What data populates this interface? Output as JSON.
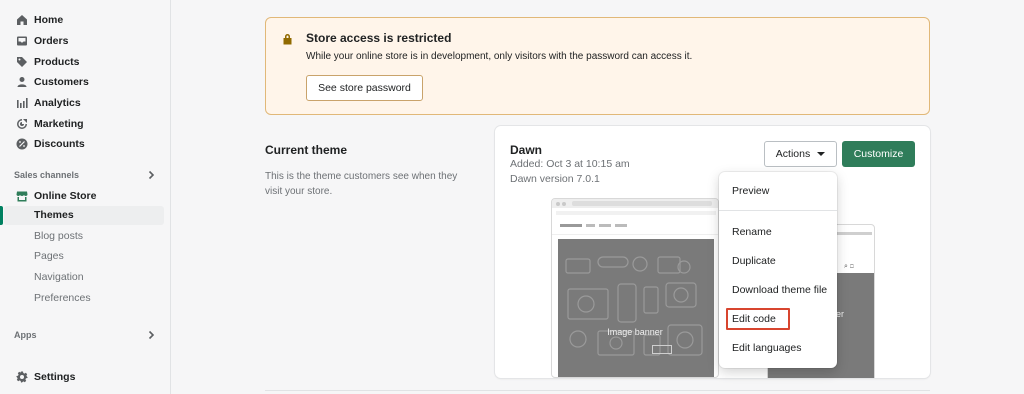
{
  "sidebar": {
    "nav": [
      {
        "label": "Home",
        "icon": "home-icon"
      },
      {
        "label": "Orders",
        "icon": "orders-icon"
      },
      {
        "label": "Products",
        "icon": "tag-icon"
      },
      {
        "label": "Customers",
        "icon": "person-icon"
      },
      {
        "label": "Analytics",
        "icon": "bar-chart-icon"
      },
      {
        "label": "Marketing",
        "icon": "target-icon"
      },
      {
        "label": "Discounts",
        "icon": "discount-icon"
      }
    ],
    "sales_channels_label": "Sales channels",
    "online_store": {
      "label": "Online Store",
      "icon": "store-icon"
    },
    "sub_items": [
      {
        "label": "Themes",
        "active": true
      },
      {
        "label": "Blog posts"
      },
      {
        "label": "Pages"
      },
      {
        "label": "Navigation"
      },
      {
        "label": "Preferences"
      }
    ],
    "apps_label": "Apps",
    "settings": {
      "label": "Settings",
      "icon": "gear-icon"
    }
  },
  "banner": {
    "title": "Store access is restricted",
    "text": "While your online store is in development, only visitors with the password can access it.",
    "button": "See store password",
    "icon": "lock-icon",
    "accent": "#e1b878",
    "background": "#fff5ea"
  },
  "current_theme": {
    "title": "Current theme",
    "description": "This is the theme customers see when they visit your store.",
    "theme_name": "Dawn",
    "added": "Added: Oct 3 at 10:15 am",
    "version": "Dawn version 7.0.1",
    "actions_label": "Actions",
    "customize_label": "Customize",
    "primary_color": "#2f7d5a",
    "preview": {
      "desktop_banner_text": "Image banner",
      "mobile_banner_text": "nner"
    }
  },
  "actions_menu": {
    "items": [
      {
        "label": "Preview"
      },
      {
        "label": "Rename"
      },
      {
        "label": "Duplicate"
      },
      {
        "label": "Download theme file"
      },
      {
        "label": "Edit code",
        "highlighted": true
      },
      {
        "label": "Edit languages"
      }
    ],
    "highlight_color": "#d8452f"
  }
}
